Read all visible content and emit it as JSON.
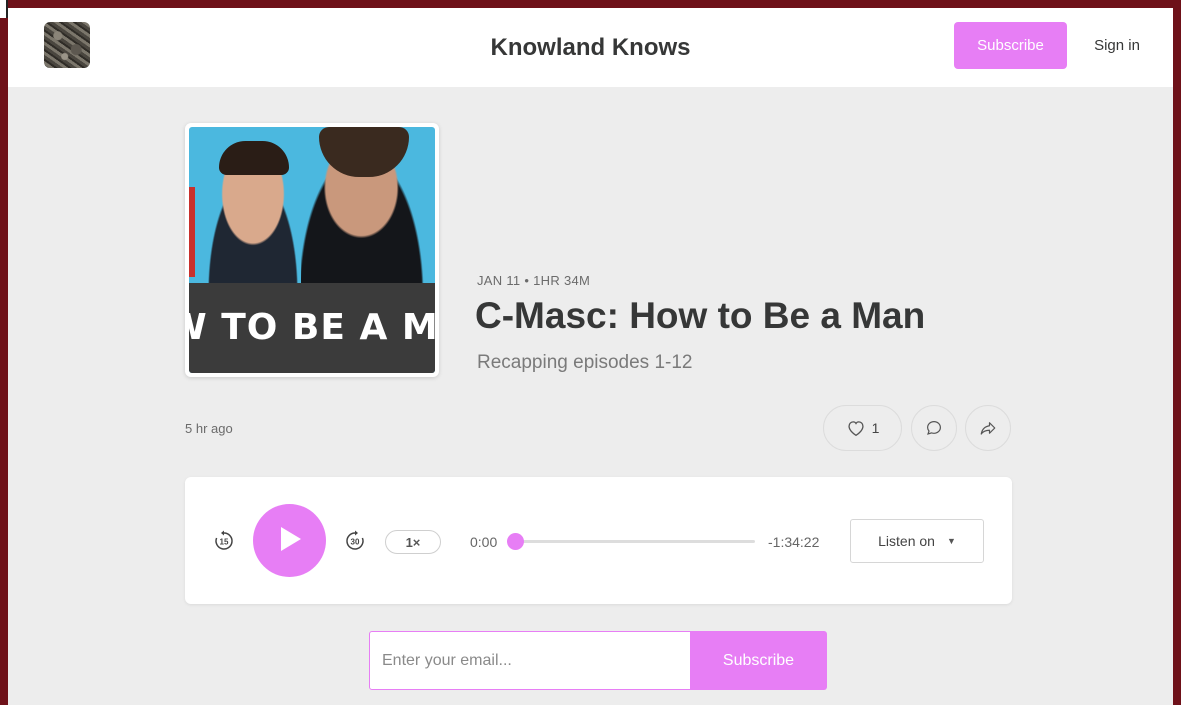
{
  "header": {
    "site_title": "Knowland Knows",
    "subscribe_label": "Subscribe",
    "signin_label": "Sign in"
  },
  "episode": {
    "cover_text": "W TO BE A M",
    "meta": "JAN 11 • 1HR 34M",
    "title": "C-Masc: How to Be a Man",
    "subtitle": "Recapping episodes 1-12",
    "posted": "5 hr ago",
    "like_count": "1"
  },
  "player": {
    "skip_back": "15",
    "skip_forward": "30",
    "speed": "1×",
    "current_time": "0:00",
    "remaining_time": "-1:34:22",
    "progress": 0.0,
    "listen_on_label": "Listen on",
    "caret": "▼"
  },
  "subscribe_form": {
    "email_placeholder": "Enter your email...",
    "submit_label": "Subscribe"
  },
  "colors": {
    "accent": "#e77ef5",
    "frame": "#6e1119",
    "background": "#ededed"
  },
  "icons": [
    "publication-logo",
    "heart-icon",
    "comment-icon",
    "share-icon",
    "skip-back-15-icon",
    "play-icon",
    "skip-forward-30-icon",
    "caret-down-icon"
  ]
}
